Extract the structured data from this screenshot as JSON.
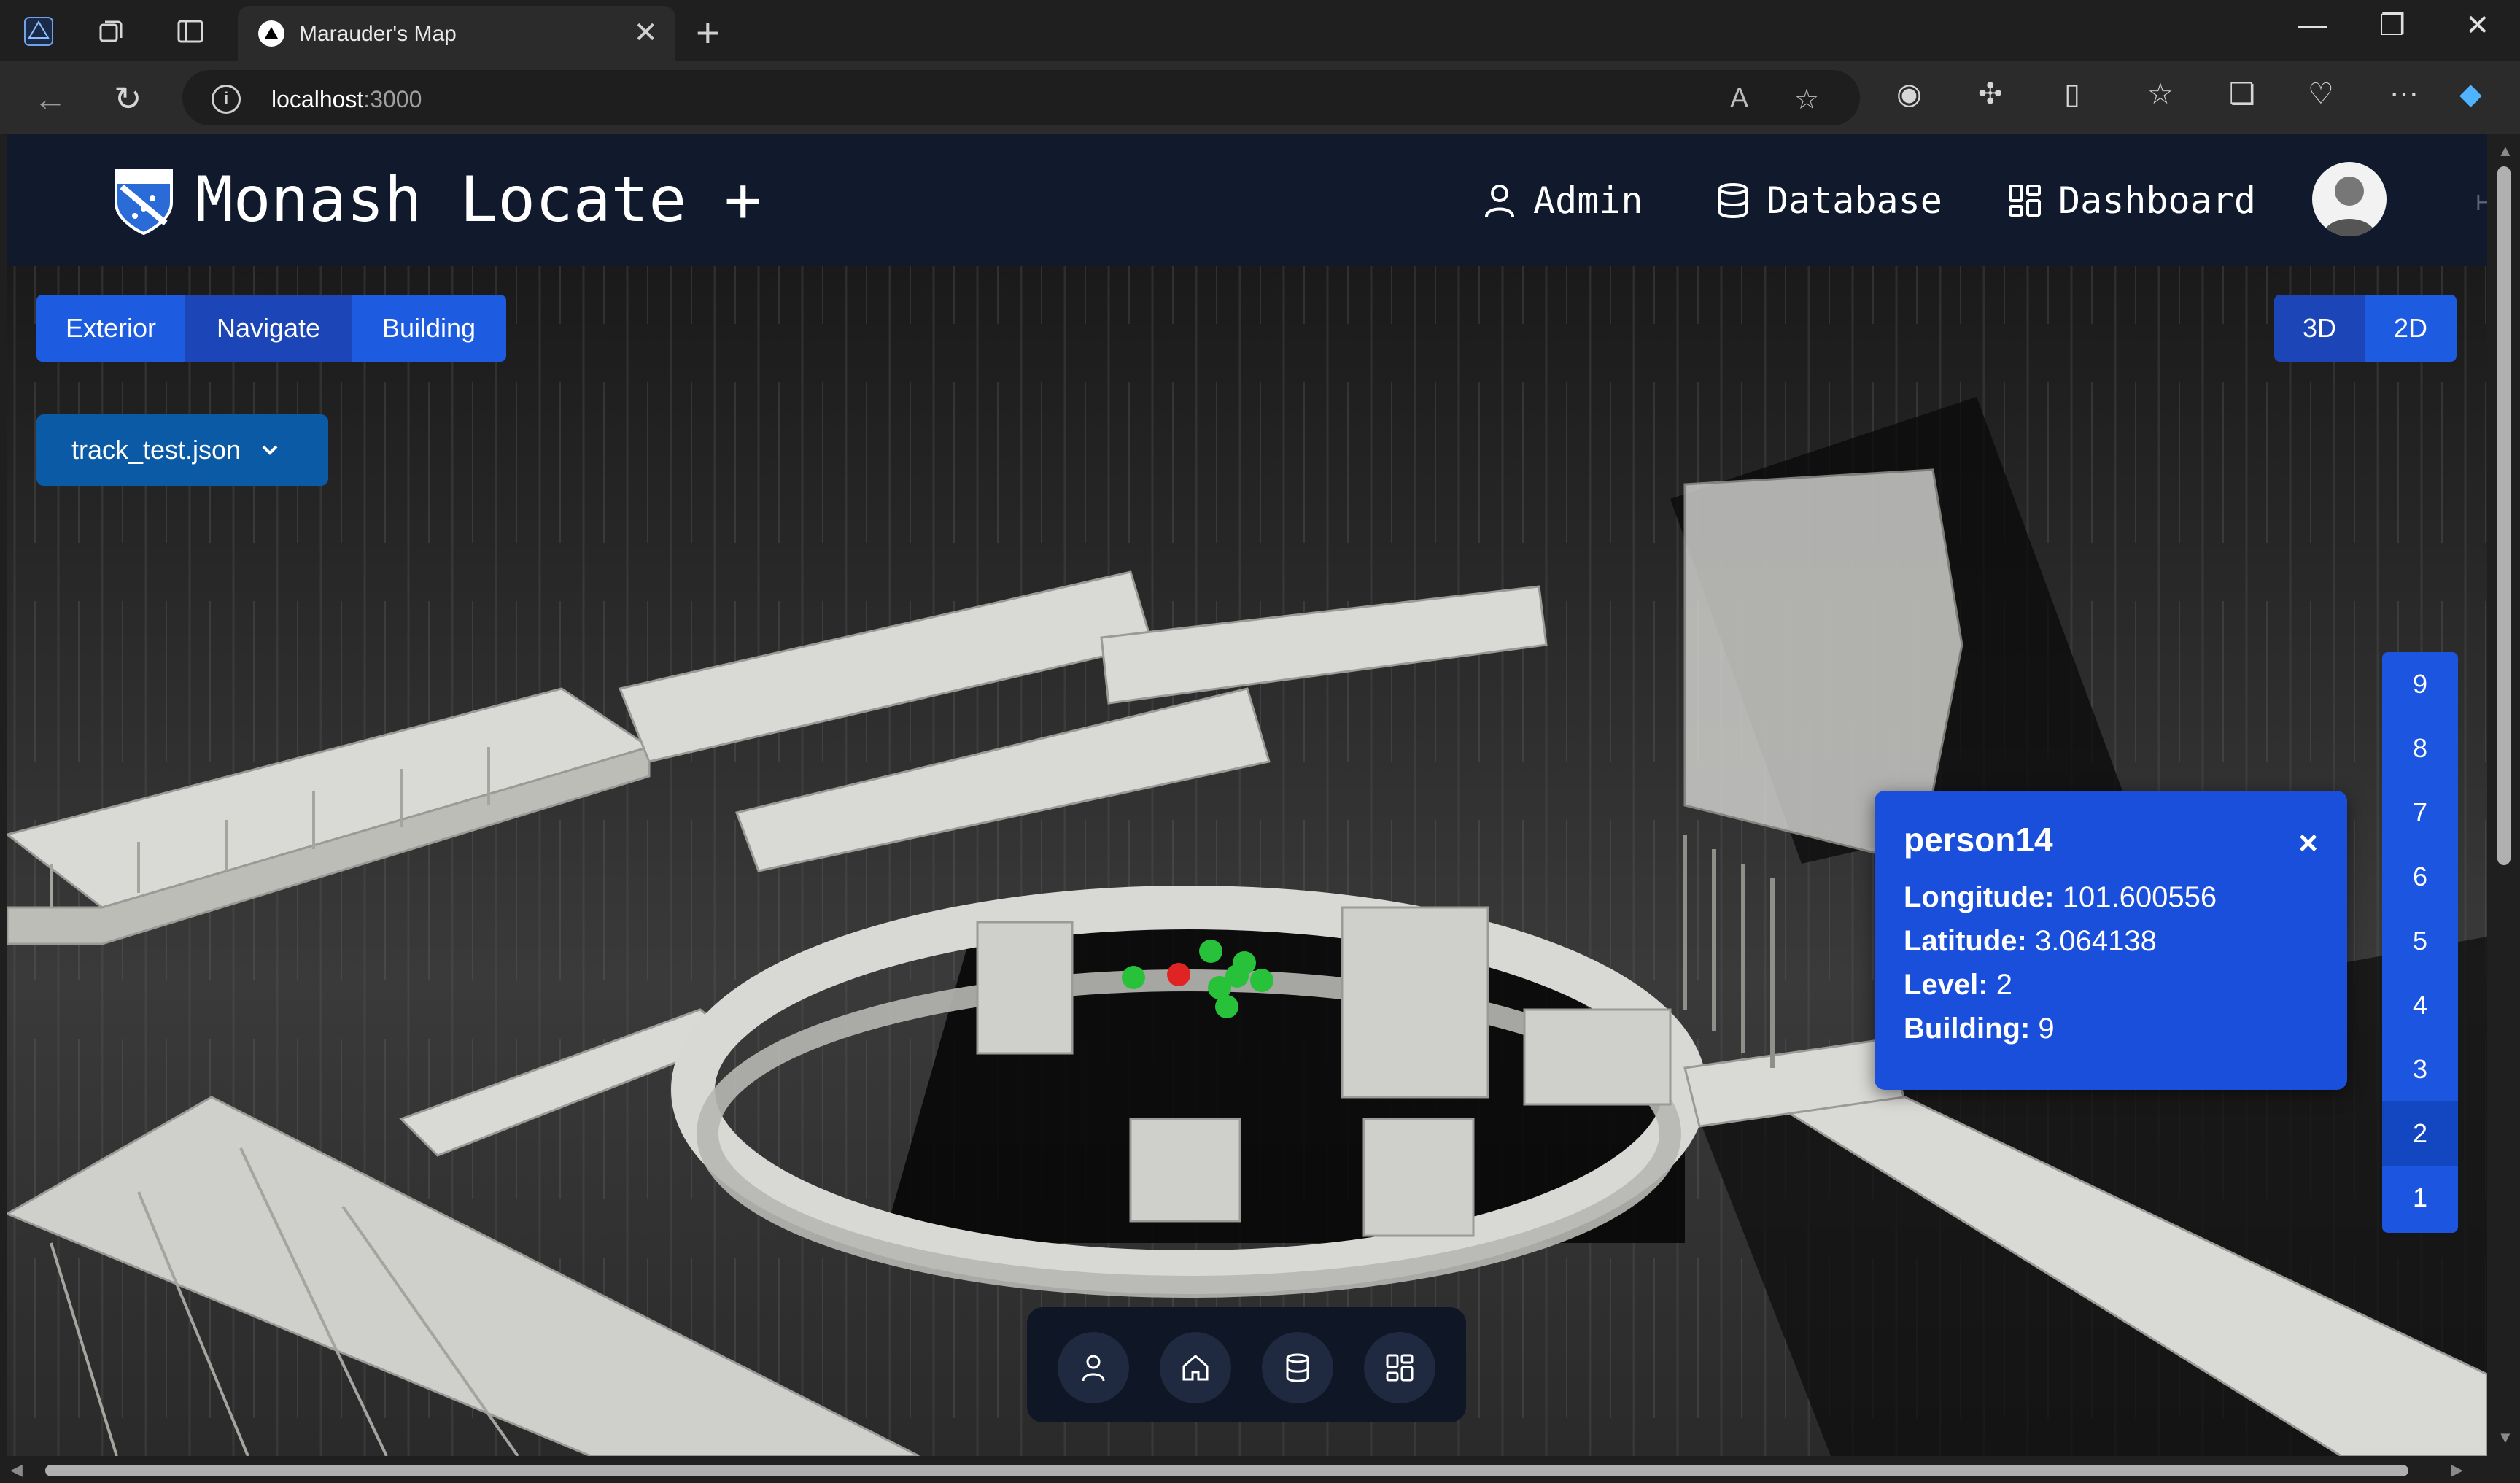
{
  "browser": {
    "tab_title": "Marauder's Map",
    "tab_close": "✕",
    "new_tab": "+",
    "url_host": "localhost",
    "url_port": ":3000",
    "window_controls": {
      "minimize": "—",
      "restore": "❐",
      "close": "✕"
    }
  },
  "app": {
    "brand": "Monash Locate +",
    "nav": {
      "admin": "Admin",
      "database": "Database",
      "dashboard": "Dashboard"
    },
    "header_cutoff": "H",
    "view_modes": [
      "Exterior",
      "Navigate",
      "Building"
    ],
    "dimension_toggle": [
      "3D",
      "2D"
    ],
    "dataset_select": "track_test.json",
    "levels": [
      "9",
      "8",
      "7",
      "6",
      "5",
      "4",
      "3",
      "2",
      "1"
    ],
    "selected_level": "2",
    "popup": {
      "name": "person14",
      "close": "×",
      "longitude_label": "Longitude:",
      "longitude": "101.600556",
      "latitude_label": "Latitude:",
      "latitude": "3.064138",
      "level_label": "Level:",
      "level": "2",
      "building_label": "Building:",
      "building": "9"
    },
    "bottom_icons": [
      "user-icon",
      "home-icon",
      "database-icon",
      "dashboard-icon"
    ],
    "markers": {
      "green": "#27c13a",
      "red": "#e02424",
      "count_green": 7,
      "count_red": 1
    }
  },
  "colors": {
    "accent": "#1d5be0",
    "header_bg": "#111a2d",
    "popup_bg": "#1a4fdc"
  }
}
